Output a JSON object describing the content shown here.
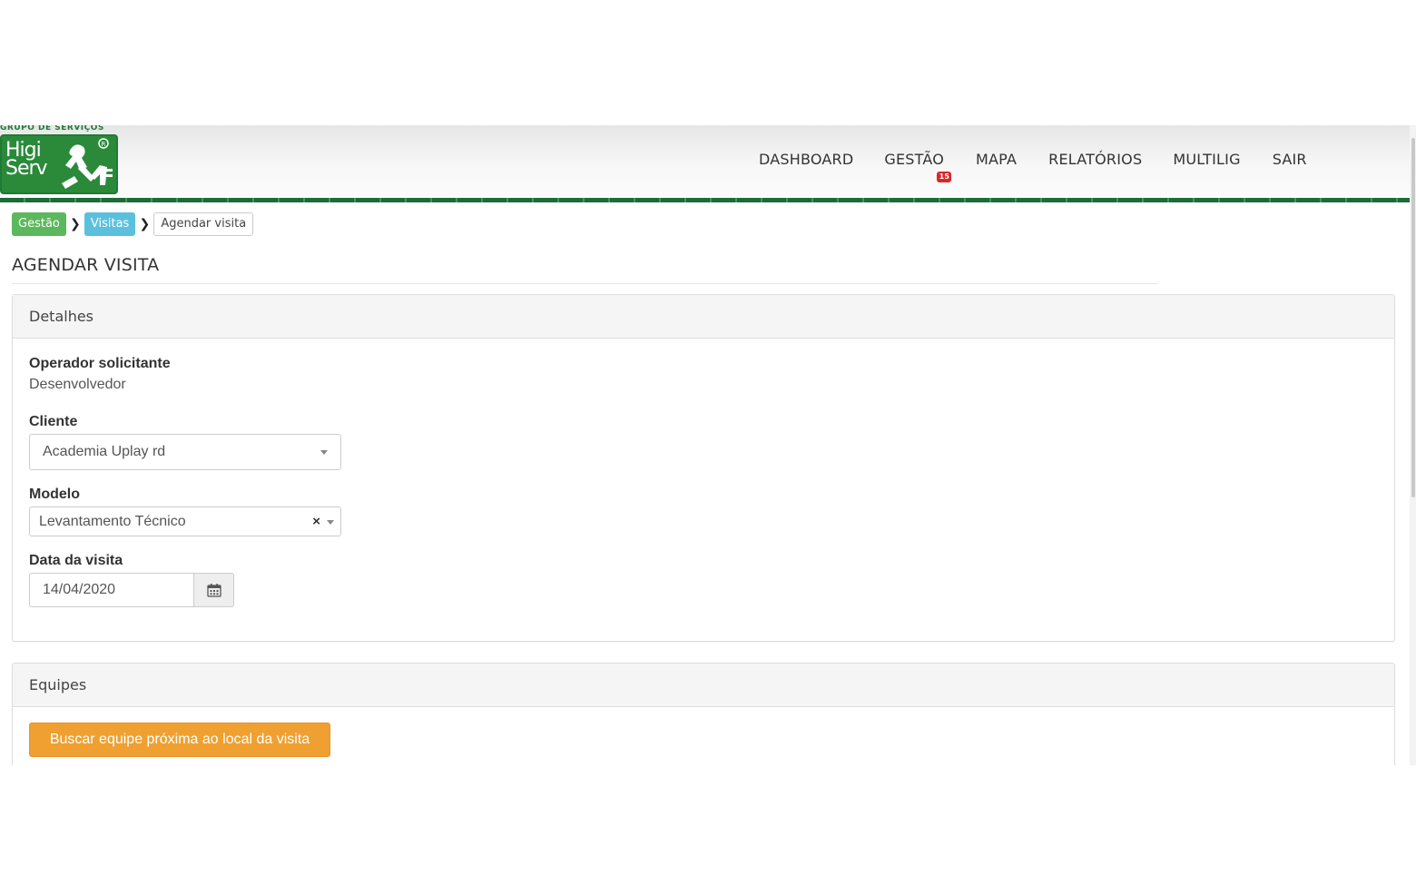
{
  "logo": {
    "top_text": "GRUPO DE SERVIÇOS",
    "word_line1": "Higi",
    "word_line2": "Serv",
    "brand_color": "#2a8a3a"
  },
  "nav": {
    "items": [
      {
        "label": "DASHBOARD"
      },
      {
        "label": "GESTÃO",
        "badge": "15"
      },
      {
        "label": "MAPA"
      },
      {
        "label": "RELATÓRIOS"
      },
      {
        "label": "MULTILIG"
      },
      {
        "label": "SAIR"
      }
    ],
    "badge_color": "#d9272e"
  },
  "breadcrumb": {
    "items": [
      {
        "label": "Gestão",
        "color": "#5cb85c"
      },
      {
        "label": "Visitas",
        "color": "#5bc0de"
      },
      {
        "label": "Agendar visita"
      }
    ],
    "separator_icon": "chevron-right-icon"
  },
  "page": {
    "title": "AGENDAR VISITA"
  },
  "details_panel": {
    "heading": "Detalhes",
    "operador_label": "Operador solicitante",
    "operador_value": "Desenvolvedor",
    "cliente_label": "Cliente",
    "cliente_value": "Academia Uplay rd",
    "modelo_label": "Modelo",
    "modelo_value": "Levantamento Técnico",
    "modelo_clear": "×",
    "data_label": "Data da visita",
    "data_value": "14/04/2020",
    "calendar_icon": "calendar-icon"
  },
  "equipes_panel": {
    "heading": "Equipes",
    "search_button": "Buscar equipe próxima ao local da visita",
    "button_color": "#f0a030"
  }
}
